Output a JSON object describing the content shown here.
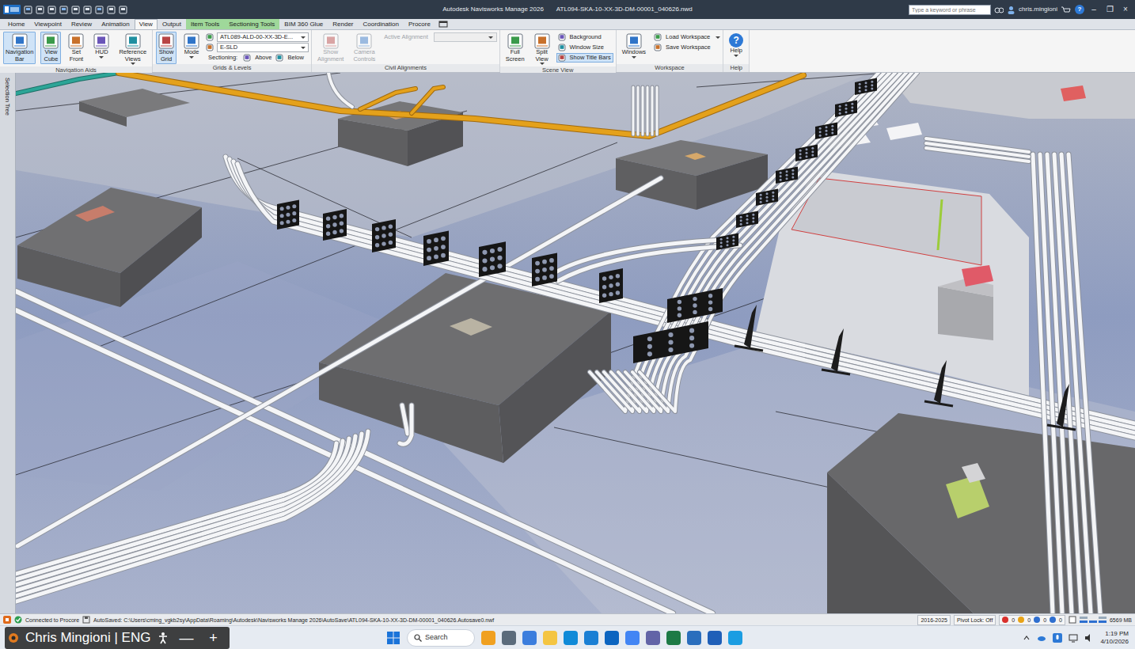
{
  "window": {
    "title": "Autodesk Navisworks Manage 2026",
    "file": "ATL094-SKA-10-XX-3D-DM-00001_040626.nwd",
    "search_placeholder": "Type a keyword or phrase",
    "user": "chris.mingioni",
    "help": "?",
    "controls": [
      "–",
      "❐",
      "×"
    ]
  },
  "tabs": [
    {
      "label": "Home",
      "selected": false,
      "contextual": false
    },
    {
      "label": "Viewpoint",
      "selected": false,
      "contextual": false
    },
    {
      "label": "Review",
      "selected": false,
      "contextual": false
    },
    {
      "label": "Animation",
      "selected": false,
      "contextual": false
    },
    {
      "label": "View",
      "selected": true,
      "contextual": false
    },
    {
      "label": "Output",
      "selected": false,
      "contextual": false
    },
    {
      "label": "Item Tools",
      "selected": false,
      "contextual": true
    },
    {
      "label": "Sectioning Tools",
      "selected": false,
      "contextual": true
    },
    {
      "label": "BIM 360 Glue",
      "selected": false,
      "contextual": false
    },
    {
      "label": "Render",
      "selected": false,
      "contextual": false
    },
    {
      "label": "Coordination",
      "selected": false,
      "contextual": false
    },
    {
      "label": "Procore",
      "selected": false,
      "contextual": false
    }
  ],
  "ribbon": [
    {
      "label": "Navigation Aids",
      "items": [
        {
          "kind": "large",
          "label": "Navigation Bar",
          "active": true,
          "disabled": false,
          "caret": false
        },
        {
          "kind": "large",
          "label": "View Cube",
          "active": true,
          "disabled": false,
          "caret": false
        },
        {
          "kind": "large",
          "label": "Set Front",
          "active": false,
          "disabled": false,
          "caret": false
        },
        {
          "kind": "large",
          "label": "HUD",
          "active": false,
          "disabled": false,
          "caret": true
        },
        {
          "kind": "large",
          "label": "Reference Views",
          "active": false,
          "disabled": false,
          "caret": true
        }
      ]
    },
    {
      "label": "Grids & Levels",
      "items": [
        {
          "kind": "large",
          "label": "Show Grid",
          "active": true,
          "disabled": false,
          "caret": false
        },
        {
          "kind": "large",
          "label": "Mode",
          "active": false,
          "disabled": false,
          "caret": true
        },
        {
          "kind": "dropdown",
          "label": "ATL089-ALD-00-XX-3D-E...",
          "active": false,
          "disabled": false,
          "caret": true
        },
        {
          "kind": "dropdown",
          "label": "E-SLD",
          "active": false,
          "disabled": false,
          "caret": true
        },
        {
          "kind": "sectioning",
          "label": "Sectioning:",
          "active": false,
          "disabled": false,
          "caret": false,
          "options": [
            "Above",
            "Below"
          ]
        }
      ]
    },
    {
      "label": "Civil Alignments",
      "items": [
        {
          "kind": "large",
          "label": "Show Alignment",
          "active": false,
          "disabled": true,
          "caret": false
        },
        {
          "kind": "large",
          "label": "Camera Controls",
          "active": false,
          "disabled": true,
          "caret": false
        },
        {
          "kind": "field",
          "label": "Active Alignment",
          "active": false,
          "disabled": true,
          "caret": true
        }
      ]
    },
    {
      "label": "Scene View",
      "items": [
        {
          "kind": "large",
          "label": "Full Screen",
          "active": false,
          "disabled": false,
          "caret": false
        },
        {
          "kind": "large",
          "label": "Split View",
          "active": false,
          "disabled": false,
          "caret": true
        },
        {
          "kind": "small",
          "label": "Background",
          "active": false,
          "disabled": false,
          "caret": false
        },
        {
          "kind": "small",
          "label": "Window Size",
          "active": false,
          "disabled": false,
          "caret": false
        },
        {
          "kind": "small",
          "label": "Show Title Bars",
          "active": true,
          "disabled": false,
          "caret": false
        }
      ]
    },
    {
      "label": "Workspace",
      "items": [
        {
          "kind": "large",
          "label": "Windows",
          "active": false,
          "disabled": false,
          "caret": true
        },
        {
          "kind": "small",
          "label": "Load Workspace",
          "active": false,
          "disabled": false,
          "caret": true
        },
        {
          "kind": "small",
          "label": "Save Workspace",
          "active": false,
          "disabled": false,
          "caret": false
        }
      ]
    },
    {
      "label": "Help",
      "items": [
        {
          "kind": "large",
          "label": "Help",
          "active": false,
          "disabled": false,
          "caret": true,
          "glyph": "?"
        }
      ]
    }
  ],
  "viewport": {
    "selection_tree": "Selection Tree"
  },
  "status_bar": {
    "procore": "Connected to Procore",
    "autosave": "AutoSaved: C:\\Users\\cming_vgkb2sy\\AppData\\Roaming\\Autodesk\\Navisworks Manage 2026\\AutoSave\\ATL094-SKA-10-XX-3D-DM-00001_040626.Autosave0.nwf",
    "range": "2016-2025",
    "pivot_lock": "Pivot Lock: Off",
    "counters": [
      {
        "value": "0",
        "color": "#d9302c"
      },
      {
        "value": "0",
        "color": "#e8a317"
      },
      {
        "value": "0",
        "color": "#2f6fd0"
      },
      {
        "value": "0",
        "color": "#2f6fd0"
      }
    ],
    "memory": "6569 MB"
  },
  "taskbar": {
    "overlay": {
      "label": "Chris Mingioni | ENG",
      "buttons": [
        "—",
        "+"
      ]
    },
    "search": "Search",
    "apps": [
      {
        "color": "#f0a020"
      },
      {
        "color": "#5b6b7b"
      },
      {
        "color": "#3b7ddd"
      },
      {
        "color": "#f4c542"
      },
      {
        "color": "#0f8ad8"
      },
      {
        "color": "#1a7fd4"
      },
      {
        "color": "#0b64c0"
      },
      {
        "color": "#4285f4"
      },
      {
        "color": "#6264a7"
      },
      {
        "color": "#1d7a45"
      },
      {
        "color": "#2a6ebd"
      },
      {
        "color": "#1f5fb8"
      },
      {
        "color": "#1b9de2"
      }
    ],
    "time": "1:19 PM",
    "date": "4/10/2026"
  }
}
